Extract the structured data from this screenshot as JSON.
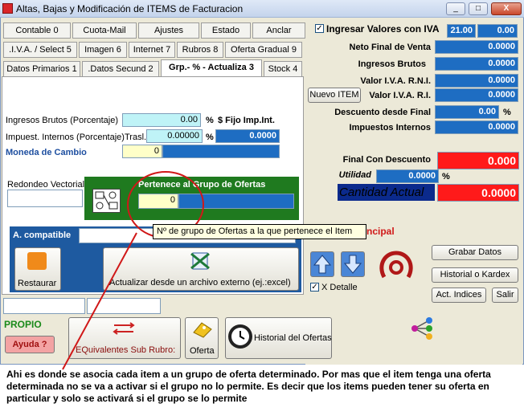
{
  "window": {
    "title": "Altas, Bajas y Modificación de ITEMS de Facturacion",
    "min": "_",
    "max": "□",
    "close": "X"
  },
  "tabs_row1": [
    "Contable 0",
    "Cuota-Mail",
    "Ajustes",
    "Estado",
    "Anclar"
  ],
  "tabs_row2": [
    ".I.V.A. / Select 5",
    "Imagen 6",
    "Internet 7",
    "Rubros 8",
    "Oferta Gradual 9"
  ],
  "tabs_row3": [
    "Datos Primarios 1",
    ".Datos Secund 2",
    "Grp.- % - Actualiza 3",
    "Stock 4"
  ],
  "form": {
    "ingresos_brutos_label": "Ingresos Brutos (Porcentaje)",
    "ingresos_brutos_value": "0.00",
    "percent": "%",
    "fijo_label": "$ Fijo Imp.Int.",
    "impuest_label": "Impuest. Internos (Porcentaje)",
    "trasl_label": "Trasl.",
    "impuest_value": "0.00000",
    "fijo_value": "0.0000",
    "moneda_label": "Moneda de Cambio",
    "moneda_value": "0",
    "redondeo_label": "Redondeo Vectorial",
    "pertenece_label": "Pertenece al Grupo de Ofertas",
    "pertenece_value": "0",
    "a_compatible_label": "A. compatible",
    "restaurar_label": "Restaurar",
    "actualizar_label": "Actualizar desde un archivo externo (ej.:excel)"
  },
  "tooltip": "Nº de grupo de Ofertas a la que pertenece el Item",
  "right": {
    "iva_label": "Ingresar Valores con IVA",
    "iva_value1": "21.00",
    "iva_value2": "0.00",
    "rows": [
      {
        "label": "Neto Final de Venta",
        "value": "0.0000"
      },
      {
        "label": "Ingresos Brutos",
        "value": "0.0000"
      },
      {
        "label": "Valor I.V.A. R.N.I.",
        "value": "0.0000"
      },
      {
        "label": "Valor I.V.A. R.I.",
        "value": "0.0000"
      },
      {
        "label": "Descuento desde Final",
        "value": "0.00"
      },
      {
        "label": "Impuestos Internos",
        "value": "0.0000"
      }
    ],
    "nuevo_item": "Nuevo ITEM",
    "final_desc_label": "Final Con Descuento",
    "final_desc_value": "0.000",
    "utilidad_label": "Utilidad",
    "utilidad_value": "0.0000",
    "utilidad_pct": "%",
    "cantidad_label": "Cantidad Actual",
    "cantidad_value": "0.0000",
    "principal_text": "ncipal",
    "grabar": "Grabar Datos",
    "historial_kardex": "Historial o Kardex",
    "act_indices": "Act. Indices",
    "salir": "Salir",
    "x_detalle": "X Detalle"
  },
  "bottom": {
    "propio": "PROPIO",
    "ayuda": "Ayuda ?",
    "equivalentes": "EQuivalentes Sub Rubro:",
    "oferta": "Oferta",
    "historial_ofertas": "Historial del Ofertas"
  },
  "caption": "Ahi es donde se asocia cada item a un grupo de oferta determinado. Por mas que el item tenga una oferta determinada no se va a activar si el grupo no lo permite. Es decir que los items pueden tener su oferta en particular y solo se activará si el grupo se lo permite",
  "colors": {
    "blue_field": "#1e6dc2",
    "red_field": "#ff1a1a",
    "green_panel": "#1f7a1f",
    "teal_panel": "#1e5aa0",
    "annotation": "#d01818"
  }
}
